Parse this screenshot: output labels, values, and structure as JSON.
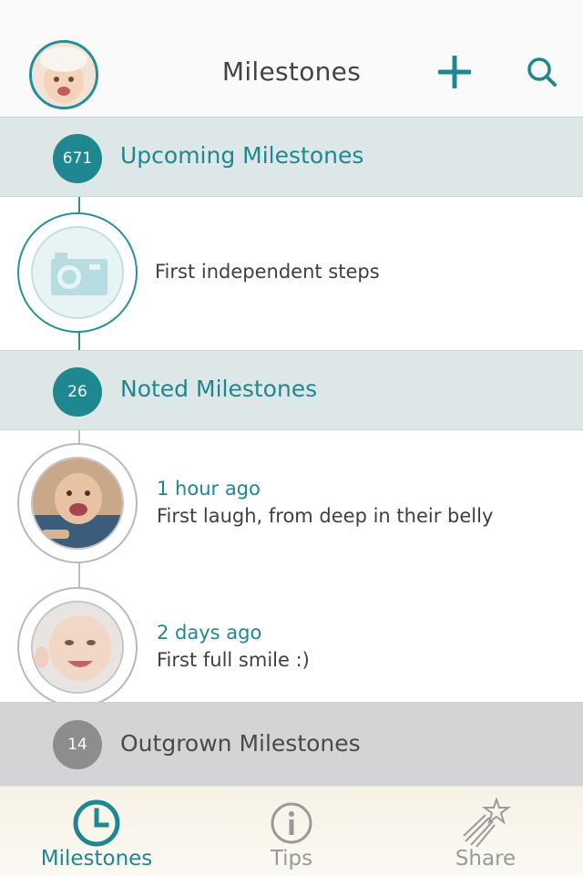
{
  "header": {
    "title": "Milestones",
    "avatar_icon": "baby-avatar",
    "add_icon": "plus-icon",
    "search_icon": "search-icon"
  },
  "sections": {
    "upcoming": {
      "count": "671",
      "label": "Upcoming Milestones"
    },
    "noted": {
      "count": "26",
      "label": "Noted Milestones"
    },
    "outgrown": {
      "count": "14",
      "label": "Outgrown Milestones"
    }
  },
  "upcoming_items": [
    {
      "title": "First independent steps",
      "icon": "camera-icon"
    }
  ],
  "noted_items": [
    {
      "time": "1 hour ago",
      "title": "First laugh, from deep in their belly"
    },
    {
      "time": "2 days ago",
      "title": "First full smile :)"
    }
  ],
  "tabbar": {
    "tabs": [
      {
        "label": "Milestones",
        "icon": "clock-icon",
        "active": true
      },
      {
        "label": "Tips",
        "icon": "info-icon",
        "active": false
      },
      {
        "label": "Share",
        "icon": "shooting-star-icon",
        "active": false
      }
    ]
  },
  "colors": {
    "accent": "#1f8790",
    "section_bg": "#dde7e8",
    "outgrown_bg": "#d4d4d6",
    "tabbar_bg": "#f7f2e6"
  }
}
